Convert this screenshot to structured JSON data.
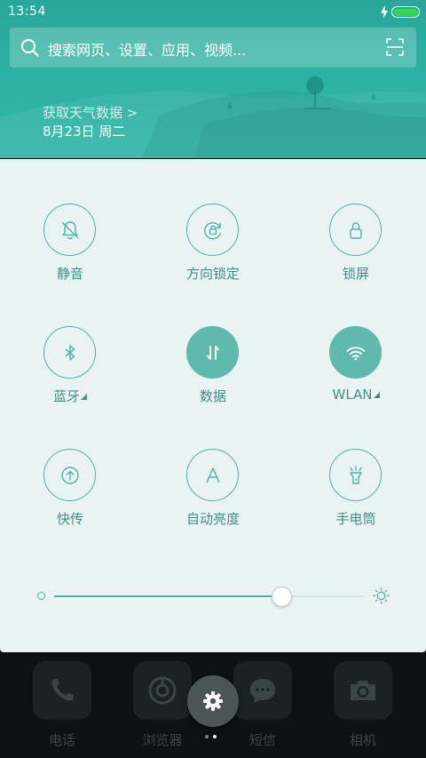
{
  "status_bar": {
    "time": "13:54"
  },
  "search": {
    "placeholder": "搜索网页、设置、应用、视频..."
  },
  "weather": {
    "link": "获取天气数据 >",
    "date": "8月23日 周二"
  },
  "toggles": [
    {
      "label": "静音",
      "icon": "silent-bell-icon",
      "state": "off"
    },
    {
      "label": "方向锁定",
      "icon": "rotation-lock-icon",
      "state": "off"
    },
    {
      "label": "锁屏",
      "icon": "lock-icon",
      "state": "off"
    },
    {
      "label": "蓝牙",
      "icon": "bluetooth-icon",
      "state": "off",
      "has_menu": true
    },
    {
      "label": "数据",
      "icon": "mobile-data-icon",
      "state": "on"
    },
    {
      "label": "WLAN",
      "icon": "wifi-icon",
      "state": "on",
      "has_menu": true
    },
    {
      "label": "快传",
      "icon": "quick-transfer-icon",
      "state": "off"
    },
    {
      "label": "自动亮度",
      "icon": "auto-brightness-icon",
      "state": "off"
    },
    {
      "label": "手电筒",
      "icon": "flashlight-icon",
      "state": "off"
    }
  ],
  "brightness": {
    "level": 0.73
  },
  "dock": {
    "apps": [
      {
        "label": "电话",
        "icon": "phone-icon"
      },
      {
        "label": "浏览器",
        "icon": "browser-icon"
      },
      {
        "label": "短信",
        "icon": "messages-icon"
      },
      {
        "label": "相机",
        "icon": "camera-icon"
      }
    ],
    "settings_icon": "gear-icon",
    "page_count": 2,
    "current_page": 2
  },
  "colors": {
    "accent": "#4fb2a8",
    "header": "#2cb0a3",
    "panel": "#eaf3f3",
    "battery": "#35d846"
  }
}
